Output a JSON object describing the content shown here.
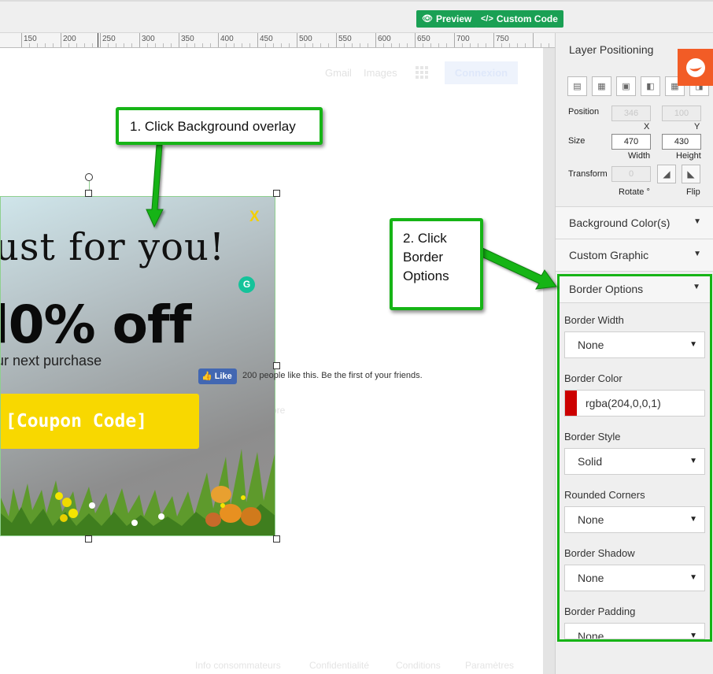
{
  "toolbar": {
    "preview_label": "Preview",
    "custom_code_label": "Custom Code",
    "preview_icon": "eye-icon",
    "code_icon": "code-icon"
  },
  "ruler": {
    "labels": [
      "150",
      "200",
      "250",
      "300",
      "350",
      "400",
      "450",
      "500",
      "550",
      "600",
      "650",
      "700",
      "750"
    ]
  },
  "canvas": {
    "ghost_gmail": "Gmail",
    "ghost_images": "Images",
    "ghost_connexion": "Connexion",
    "ghost_more": "ore",
    "footer_links": [
      "Info consommateurs",
      "Confidentialité",
      "Conditions",
      "Paramètres"
    ]
  },
  "popup": {
    "headline": "ust for you!",
    "discount": "l0% off",
    "subtext": "ur next purchase",
    "coupon": "[Coupon Code]",
    "close": "X",
    "grammarly": "G",
    "yellow": "#f8d800"
  },
  "facebook": {
    "like_label": "Like",
    "like_text": "200 people like this. Be the first of your friends."
  },
  "annotations": {
    "step1": "1. Click Background overlay",
    "step2": "2. Click Border Options",
    "accent": "#16b416"
  },
  "panel": {
    "layer_positioning_title": "Layer Positioning",
    "position_label": "Position",
    "position_x": "346",
    "position_y": "100",
    "x_label": "X",
    "y_label": "Y",
    "size_label": "Size",
    "width_value": "470",
    "height_value": "430",
    "width_label": "Width",
    "height_label": "Height",
    "transform_label": "Transform",
    "rotate_value": "0",
    "rotate_label": "Rotate °",
    "flip_label": "Flip",
    "background_colors": "Background Color(s)",
    "custom_graphic": "Custom Graphic",
    "border_options": "Border Options"
  },
  "border_options": {
    "border_width_label": "Border Width",
    "border_width_value": "None",
    "border_color_label": "Border Color",
    "border_color_value": "rgba(204,0,0,1)",
    "border_style_label": "Border Style",
    "border_style_value": "Solid",
    "rounded_corners_label": "Rounded Corners",
    "rounded_corners_value": "None",
    "border_shadow_label": "Border Shadow",
    "border_shadow_value": "None",
    "border_padding_label": "Border Padding",
    "border_padding_value": "None"
  }
}
